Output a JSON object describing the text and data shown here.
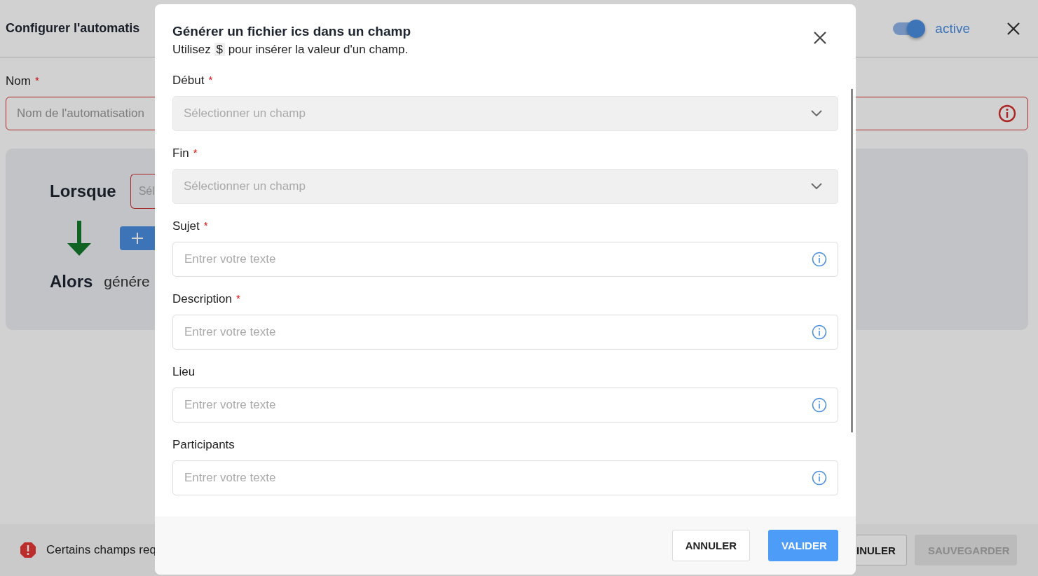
{
  "page": {
    "title": "Configurer l'automatis",
    "toggle": {
      "on": true,
      "label": "active"
    },
    "name_field": {
      "label": "Nom",
      "required_mark": "*",
      "placeholder": "Nom de l'automatisation",
      "error": true
    },
    "rule": {
      "when_label": "Lorsque",
      "when_select": "Sél",
      "then_label": "Alors",
      "then_action": "génére"
    },
    "footer": {
      "message": "Certains champs req",
      "buttons": [
        {
          "label": "INULER",
          "disabled": false
        },
        {
          "label": "SAUVEGARDER",
          "disabled": true
        }
      ]
    }
  },
  "dialog": {
    "title": "Générer un fichier ics dans un champ",
    "subtitle_before": "Utilisez",
    "code": "$",
    "subtitle_after": "pour insérer la valeur d'un champ.",
    "fields": [
      {
        "kind": "select",
        "label": "Début",
        "required_mark": "*",
        "placeholder": "Sélectionner un champ",
        "disabled": true
      },
      {
        "kind": "select",
        "label": "Fin",
        "required_mark": "*",
        "placeholder": "Sélectionner un champ",
        "disabled": true
      },
      {
        "kind": "text",
        "label": "Sujet",
        "required_mark": "*",
        "placeholder": "Entrer votre texte"
      },
      {
        "kind": "text",
        "label": "Description",
        "required_mark": "*",
        "placeholder": "Entrer votre texte"
      },
      {
        "kind": "text",
        "label": "Lieu",
        "placeholder": "Entrer votre texte"
      },
      {
        "kind": "text",
        "label": "Participants",
        "placeholder": "Entrer votre texte"
      }
    ],
    "buttons": [
      {
        "label": "ANNULER",
        "primary": false
      },
      {
        "label": "VALIDER",
        "primary": true
      }
    ]
  }
}
